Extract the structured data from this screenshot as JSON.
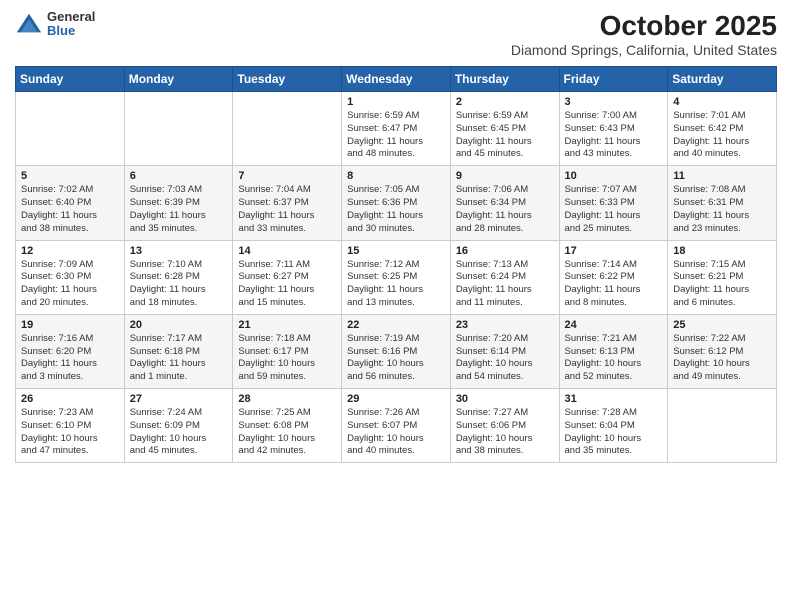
{
  "logo": {
    "general": "General",
    "blue": "Blue"
  },
  "header": {
    "title": "October 2025",
    "subtitle": "Diamond Springs, California, United States"
  },
  "weekdays": [
    "Sunday",
    "Monday",
    "Tuesday",
    "Wednesday",
    "Thursday",
    "Friday",
    "Saturday"
  ],
  "weeks": [
    [
      {
        "day": "",
        "info": ""
      },
      {
        "day": "",
        "info": ""
      },
      {
        "day": "",
        "info": ""
      },
      {
        "day": "1",
        "info": "Sunrise: 6:59 AM\nSunset: 6:47 PM\nDaylight: 11 hours\nand 48 minutes."
      },
      {
        "day": "2",
        "info": "Sunrise: 6:59 AM\nSunset: 6:45 PM\nDaylight: 11 hours\nand 45 minutes."
      },
      {
        "day": "3",
        "info": "Sunrise: 7:00 AM\nSunset: 6:43 PM\nDaylight: 11 hours\nand 43 minutes."
      },
      {
        "day": "4",
        "info": "Sunrise: 7:01 AM\nSunset: 6:42 PM\nDaylight: 11 hours\nand 40 minutes."
      }
    ],
    [
      {
        "day": "5",
        "info": "Sunrise: 7:02 AM\nSunset: 6:40 PM\nDaylight: 11 hours\nand 38 minutes."
      },
      {
        "day": "6",
        "info": "Sunrise: 7:03 AM\nSunset: 6:39 PM\nDaylight: 11 hours\nand 35 minutes."
      },
      {
        "day": "7",
        "info": "Sunrise: 7:04 AM\nSunset: 6:37 PM\nDaylight: 11 hours\nand 33 minutes."
      },
      {
        "day": "8",
        "info": "Sunrise: 7:05 AM\nSunset: 6:36 PM\nDaylight: 11 hours\nand 30 minutes."
      },
      {
        "day": "9",
        "info": "Sunrise: 7:06 AM\nSunset: 6:34 PM\nDaylight: 11 hours\nand 28 minutes."
      },
      {
        "day": "10",
        "info": "Sunrise: 7:07 AM\nSunset: 6:33 PM\nDaylight: 11 hours\nand 25 minutes."
      },
      {
        "day": "11",
        "info": "Sunrise: 7:08 AM\nSunset: 6:31 PM\nDaylight: 11 hours\nand 23 minutes."
      }
    ],
    [
      {
        "day": "12",
        "info": "Sunrise: 7:09 AM\nSunset: 6:30 PM\nDaylight: 11 hours\nand 20 minutes."
      },
      {
        "day": "13",
        "info": "Sunrise: 7:10 AM\nSunset: 6:28 PM\nDaylight: 11 hours\nand 18 minutes."
      },
      {
        "day": "14",
        "info": "Sunrise: 7:11 AM\nSunset: 6:27 PM\nDaylight: 11 hours\nand 15 minutes."
      },
      {
        "day": "15",
        "info": "Sunrise: 7:12 AM\nSunset: 6:25 PM\nDaylight: 11 hours\nand 13 minutes."
      },
      {
        "day": "16",
        "info": "Sunrise: 7:13 AM\nSunset: 6:24 PM\nDaylight: 11 hours\nand 11 minutes."
      },
      {
        "day": "17",
        "info": "Sunrise: 7:14 AM\nSunset: 6:22 PM\nDaylight: 11 hours\nand 8 minutes."
      },
      {
        "day": "18",
        "info": "Sunrise: 7:15 AM\nSunset: 6:21 PM\nDaylight: 11 hours\nand 6 minutes."
      }
    ],
    [
      {
        "day": "19",
        "info": "Sunrise: 7:16 AM\nSunset: 6:20 PM\nDaylight: 11 hours\nand 3 minutes."
      },
      {
        "day": "20",
        "info": "Sunrise: 7:17 AM\nSunset: 6:18 PM\nDaylight: 11 hours\nand 1 minute."
      },
      {
        "day": "21",
        "info": "Sunrise: 7:18 AM\nSunset: 6:17 PM\nDaylight: 10 hours\nand 59 minutes."
      },
      {
        "day": "22",
        "info": "Sunrise: 7:19 AM\nSunset: 6:16 PM\nDaylight: 10 hours\nand 56 minutes."
      },
      {
        "day": "23",
        "info": "Sunrise: 7:20 AM\nSunset: 6:14 PM\nDaylight: 10 hours\nand 54 minutes."
      },
      {
        "day": "24",
        "info": "Sunrise: 7:21 AM\nSunset: 6:13 PM\nDaylight: 10 hours\nand 52 minutes."
      },
      {
        "day": "25",
        "info": "Sunrise: 7:22 AM\nSunset: 6:12 PM\nDaylight: 10 hours\nand 49 minutes."
      }
    ],
    [
      {
        "day": "26",
        "info": "Sunrise: 7:23 AM\nSunset: 6:10 PM\nDaylight: 10 hours\nand 47 minutes."
      },
      {
        "day": "27",
        "info": "Sunrise: 7:24 AM\nSunset: 6:09 PM\nDaylight: 10 hours\nand 45 minutes."
      },
      {
        "day": "28",
        "info": "Sunrise: 7:25 AM\nSunset: 6:08 PM\nDaylight: 10 hours\nand 42 minutes."
      },
      {
        "day": "29",
        "info": "Sunrise: 7:26 AM\nSunset: 6:07 PM\nDaylight: 10 hours\nand 40 minutes."
      },
      {
        "day": "30",
        "info": "Sunrise: 7:27 AM\nSunset: 6:06 PM\nDaylight: 10 hours\nand 38 minutes."
      },
      {
        "day": "31",
        "info": "Sunrise: 7:28 AM\nSunset: 6:04 PM\nDaylight: 10 hours\nand 35 minutes."
      },
      {
        "day": "",
        "info": ""
      }
    ]
  ]
}
